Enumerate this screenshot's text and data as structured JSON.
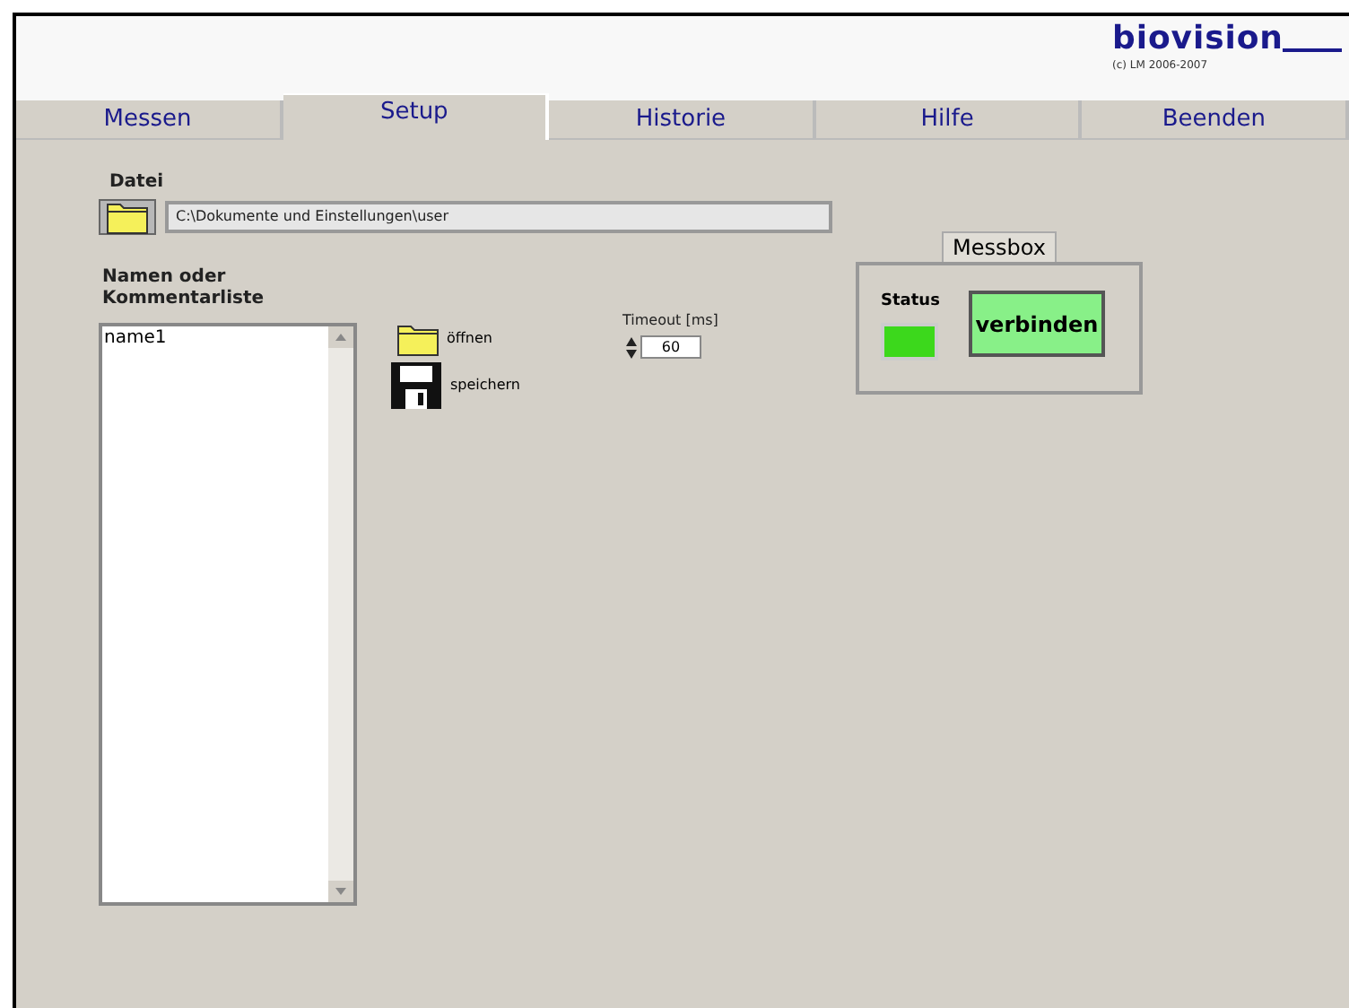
{
  "header": {
    "logo": "biovision",
    "copyright": "(c) LM 2006-2007"
  },
  "tabs": [
    {
      "label": "Messen",
      "selected": false
    },
    {
      "label": "Setup",
      "selected": true
    },
    {
      "label": "Historie",
      "selected": false
    },
    {
      "label": "Hilfe",
      "selected": false
    },
    {
      "label": "Beenden",
      "selected": false
    }
  ],
  "file": {
    "label": "Datei",
    "path": "C:\\Dokumente und Einstellungen\\user"
  },
  "list": {
    "label": "Namen oder Kommentarliste",
    "items": [
      "name1"
    ]
  },
  "actions": [
    {
      "kind": "open",
      "label": "öffnen"
    },
    {
      "kind": "save",
      "label": "speichern"
    }
  ],
  "timeout": {
    "label": "Timeout [ms]",
    "value": "60"
  },
  "messbox": {
    "title": "Messbox",
    "status_label": "Status",
    "status_on": true,
    "button": "verbinden"
  }
}
